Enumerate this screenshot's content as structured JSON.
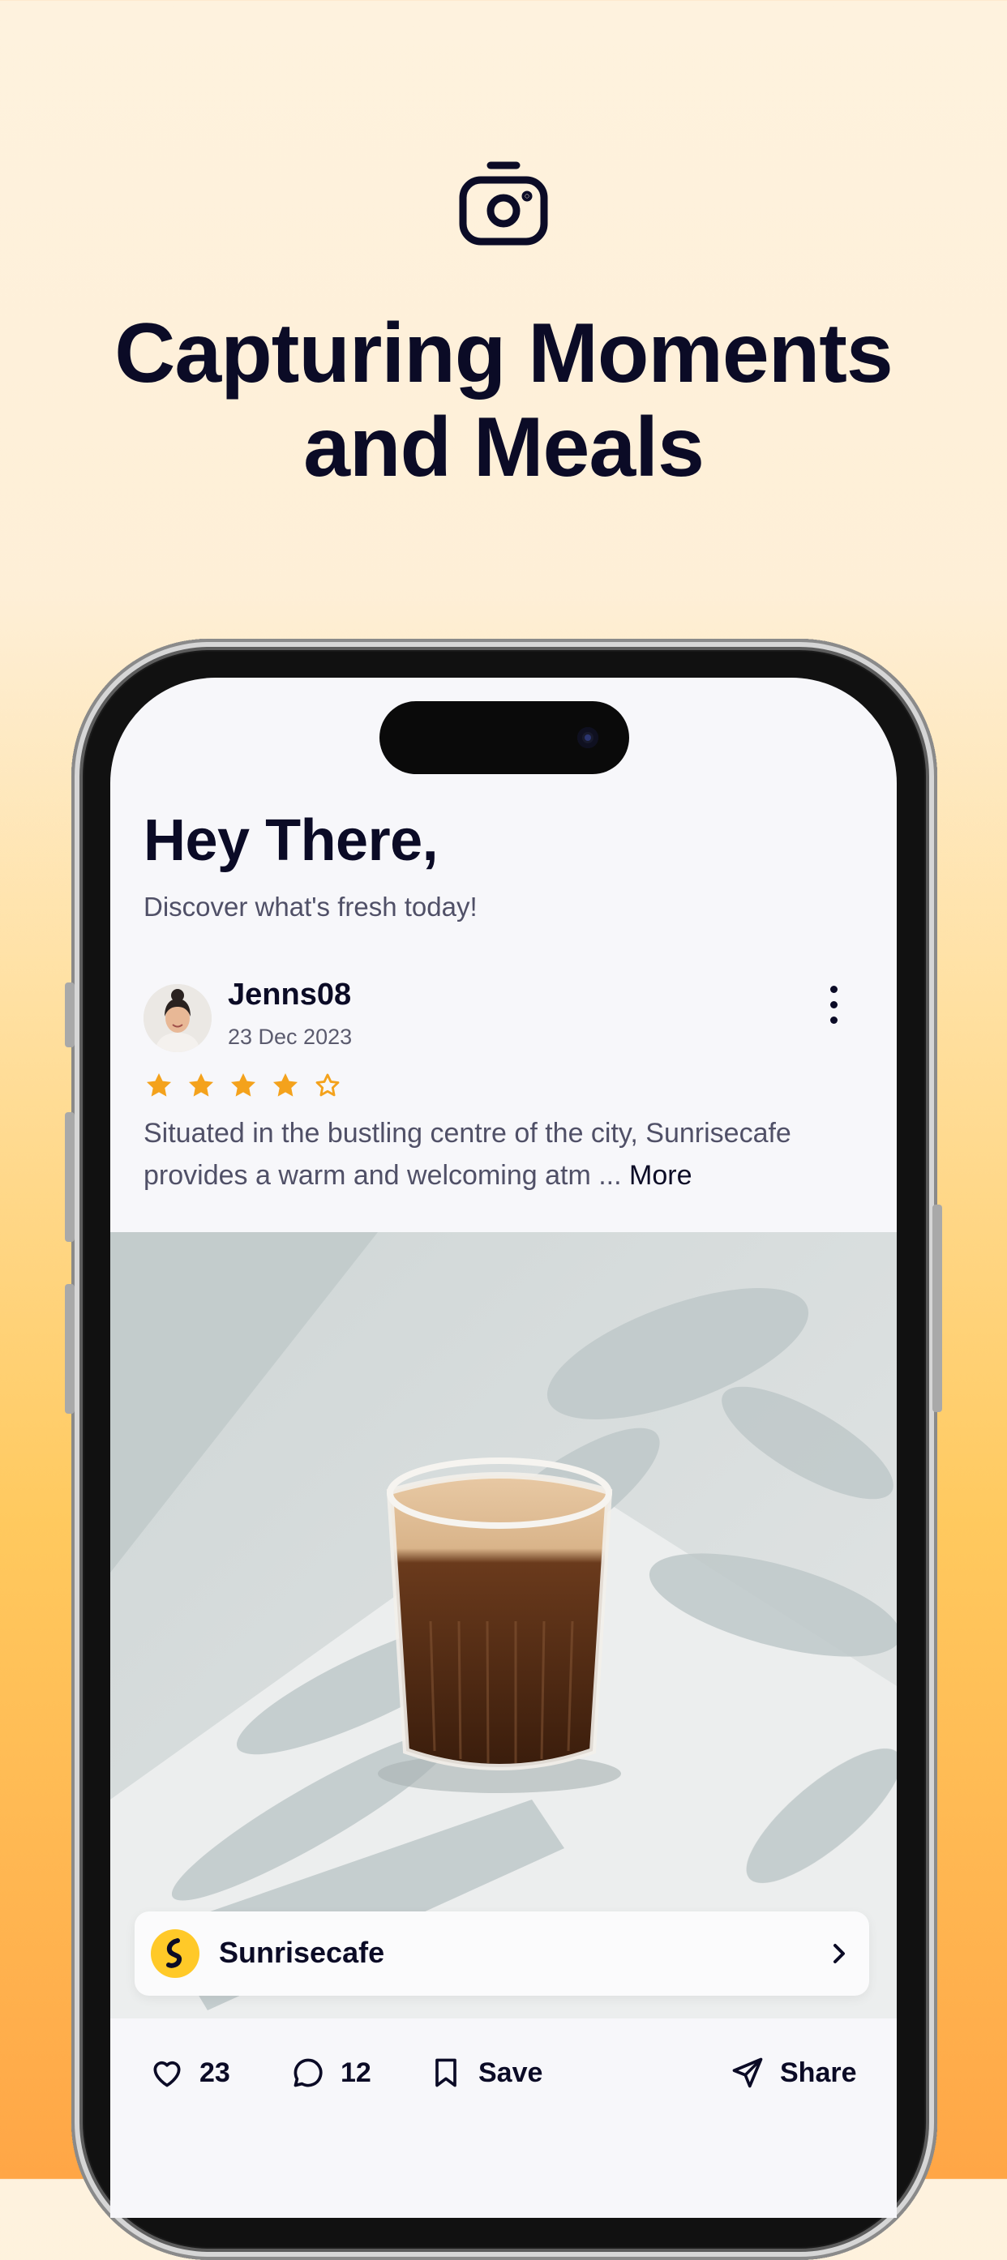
{
  "hero": {
    "icon": "camera-icon",
    "headline_line1": "Capturing Moments",
    "headline_line2": "and Meals"
  },
  "app": {
    "greeting": "Hey There,",
    "subtitle": "Discover what's fresh today!",
    "post": {
      "username": "Jenns08",
      "date": "23 Dec 2023",
      "rating": 4,
      "rating_max": 5,
      "review_text": "Situated in the bustling centre of the city, Sunrisecafe provides a warm and welcoming atm ... ",
      "more_label": "More",
      "place_name": "Sunrisecafe",
      "likes": "23",
      "comments": "12",
      "save_label": "Save",
      "share_label": "Share"
    }
  },
  "colors": {
    "accent_star": "#F4A21C",
    "text_primary": "#0B0B26",
    "text_secondary": "#505067",
    "brand_yellow": "#FFC928",
    "background_top": "#FEF2DE",
    "background_bottom": "#FFA646"
  },
  "icons": [
    "camera-icon",
    "more-vertical-icon",
    "star-icon",
    "heart-icon",
    "comment-icon",
    "bookmark-icon",
    "send-icon",
    "chevron-right-icon"
  ]
}
